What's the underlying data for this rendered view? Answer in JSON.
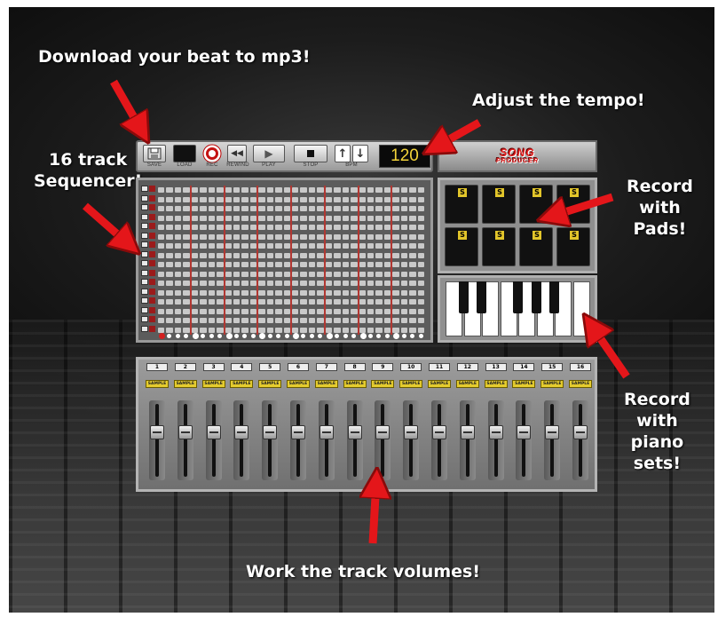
{
  "callouts": {
    "download": "Download your beat to mp3!",
    "tempo": "Adjust the tempo!",
    "sequencer": [
      "16 track",
      "Sequencer!"
    ],
    "pads": [
      "Record",
      "with",
      "Pads!"
    ],
    "piano": [
      "Record",
      "with",
      "piano",
      "sets!"
    ],
    "volumes": "Work the track volumes!"
  },
  "toolbar": {
    "save_label": "SAVE",
    "load_label": "LOAD",
    "rec_label": "REC",
    "rewind_label": "REWIND",
    "play_label": "PLAY",
    "stop_label": "STOP",
    "bpm_label": "BPM",
    "tempo_value": "120",
    "icons": {
      "save": "floppy-icon",
      "rec": "record-icon",
      "rewind": "rewind-icon",
      "play": "play-icon",
      "stop": "stop-icon",
      "bpm_up": "arrow-up-icon",
      "bpm_down": "arrow-down-icon"
    }
  },
  "logo": {
    "line1": "SONG",
    "line2": "PRODUCER"
  },
  "sequencer": {
    "tracks": 16,
    "steps": 32
  },
  "pads": {
    "count": 8,
    "badge": "S"
  },
  "piano": {
    "white_keys": 8
  },
  "mixer": {
    "channels": [
      {
        "number": "1",
        "label": "SAMPLE"
      },
      {
        "number": "2",
        "label": "SAMPLE"
      },
      {
        "number": "3",
        "label": "SAMPLE"
      },
      {
        "number": "4",
        "label": "SAMPLE"
      },
      {
        "number": "5",
        "label": "SAMPLE"
      },
      {
        "number": "6",
        "label": "SAMPLE"
      },
      {
        "number": "7",
        "label": "SAMPLE"
      },
      {
        "number": "8",
        "label": "SAMPLE"
      },
      {
        "number": "9",
        "label": "SAMPLE"
      },
      {
        "number": "10",
        "label": "SAMPLE"
      },
      {
        "number": "11",
        "label": "SAMPLE"
      },
      {
        "number": "12",
        "label": "SAMPLE"
      },
      {
        "number": "13",
        "label": "SAMPLE"
      },
      {
        "number": "14",
        "label": "SAMPLE"
      },
      {
        "number": "15",
        "label": "SAMPLE"
      },
      {
        "number": "16",
        "label": "SAMPLE"
      }
    ]
  },
  "colors": {
    "arrow": "#e4161a",
    "tempo_digits": "#f2d23a",
    "sample_tag": "#e5cc2e",
    "beat_marker": "#c0302a"
  }
}
